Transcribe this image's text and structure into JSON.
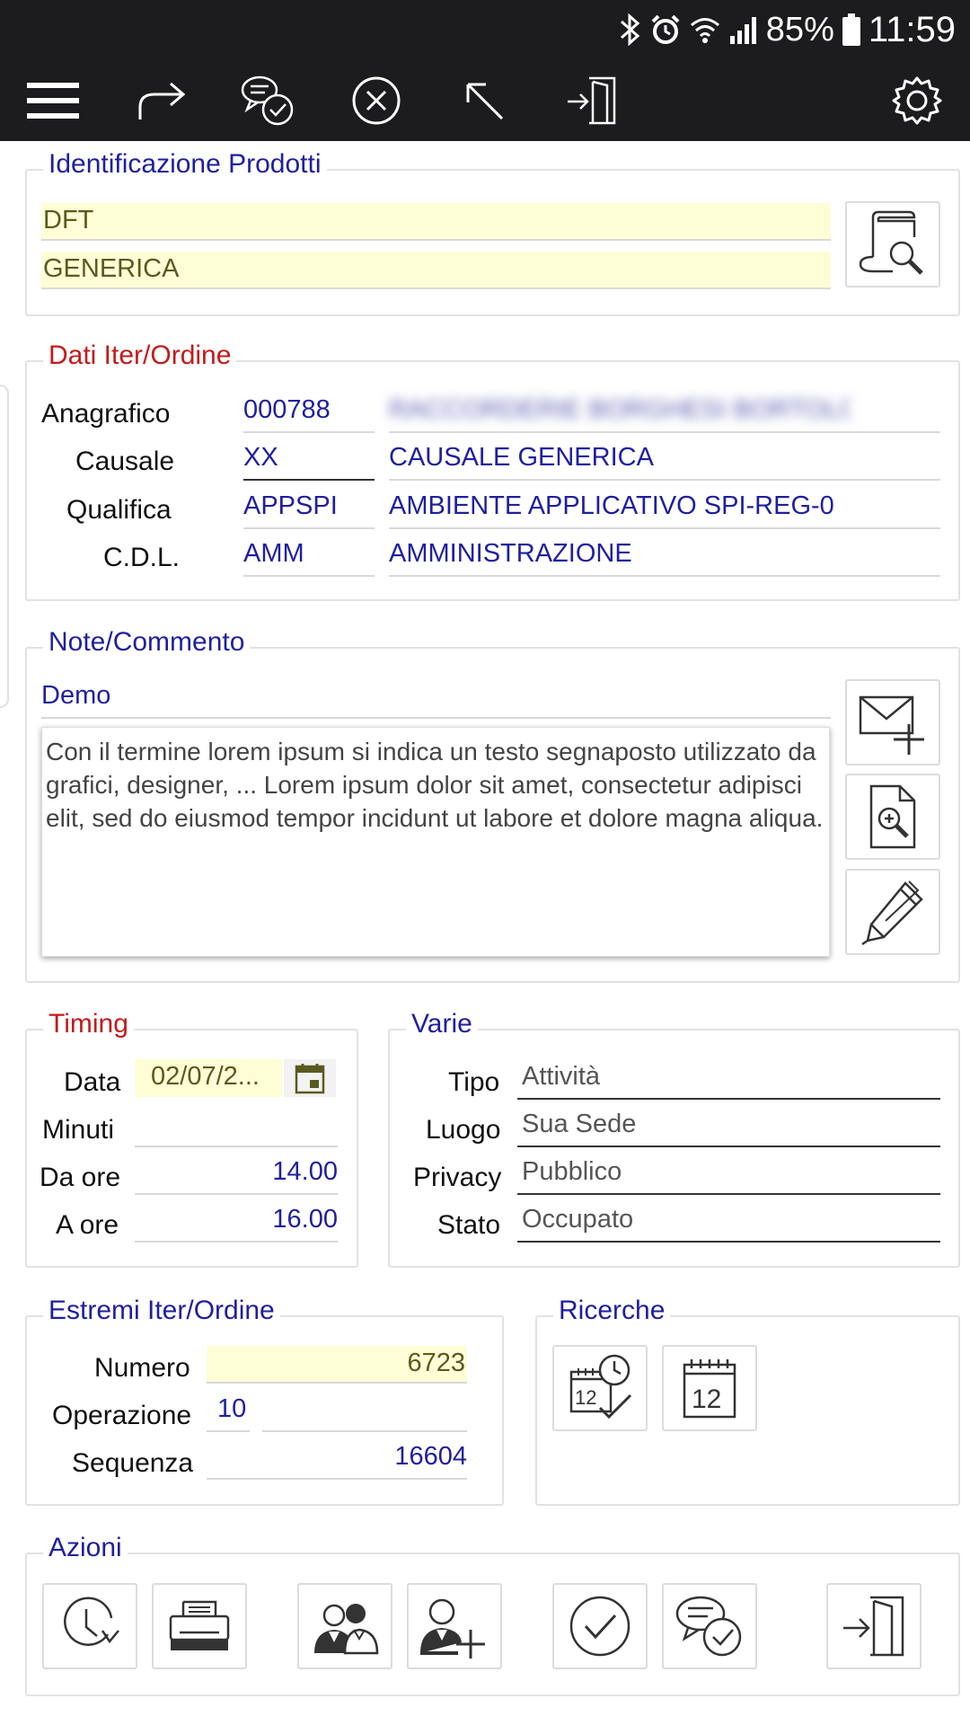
{
  "status_bar": {
    "battery": "85%",
    "time": "11:59"
  },
  "toolbar": {
    "icons": [
      "menu-icon",
      "share-forward-icon",
      "chat-check-icon",
      "cancel-circle-icon",
      "arrow-up-left-icon",
      "exit-door-icon",
      "gear-icon"
    ]
  },
  "identificazione": {
    "title": "Identificazione Prodotti",
    "field1": "DFT",
    "field2": "GENERICA"
  },
  "dati_iter": {
    "title": "Dati Iter/Ordine",
    "anagrafico": {
      "label": "Anagrafico",
      "code": "000788",
      "desc": "RACCORDERIE BORGHESI BORTOLO"
    },
    "causale": {
      "label": "Causale",
      "code": "XX",
      "desc": "CAUSALE GENERICA"
    },
    "qualifica": {
      "label": "Qualifica",
      "code": "APPSPI",
      "desc": "AMBIENTE APPLICATIVO SPI-REG-0"
    },
    "cdl": {
      "label": "C.D.L.",
      "code": "AMM",
      "desc": "AMMINISTRAZIONE"
    }
  },
  "note": {
    "title": "Note/Commento",
    "subject": "Demo",
    "body": "Con il termine lorem ipsum si indica un testo segnaposto utilizzato da grafici, designer, ... Lorem ipsum dolor sit amet, consectetur adipisci elit, sed do eiusmod tempor incidunt ut labore et dolore magna aliqua."
  },
  "timing": {
    "title": "Timing",
    "data": {
      "label": "Data",
      "value": "02/07/2..."
    },
    "minuti": {
      "label": "Minuti",
      "value": ""
    },
    "da_ore": {
      "label": "Da ore",
      "value": "14.00"
    },
    "a_ore": {
      "label": "A ore",
      "value": "16.00"
    }
  },
  "varie": {
    "title": "Varie",
    "tipo": {
      "label": "Tipo",
      "value": "Attività"
    },
    "luogo": {
      "label": "Luogo",
      "value": "Sua Sede"
    },
    "privacy": {
      "label": "Privacy",
      "value": "Pubblico"
    },
    "stato": {
      "label": "Stato",
      "value": "Occupato"
    }
  },
  "estremi": {
    "title": "Estremi Iter/Ordine",
    "numero": {
      "label": "Numero",
      "value": "6723"
    },
    "operazione": {
      "label": "Operazione",
      "value": "10",
      "value2": ""
    },
    "sequenza": {
      "label": "Sequenza",
      "value": "16604"
    }
  },
  "ricerche": {
    "title": "Ricerche"
  },
  "azioni": {
    "title": "Azioni"
  },
  "colors": {
    "label_blue": "#1f1fa0",
    "label_red": "#c41a1a",
    "highlight_yellow": "#fefed6",
    "bar_dark": "#1c1c1e"
  }
}
